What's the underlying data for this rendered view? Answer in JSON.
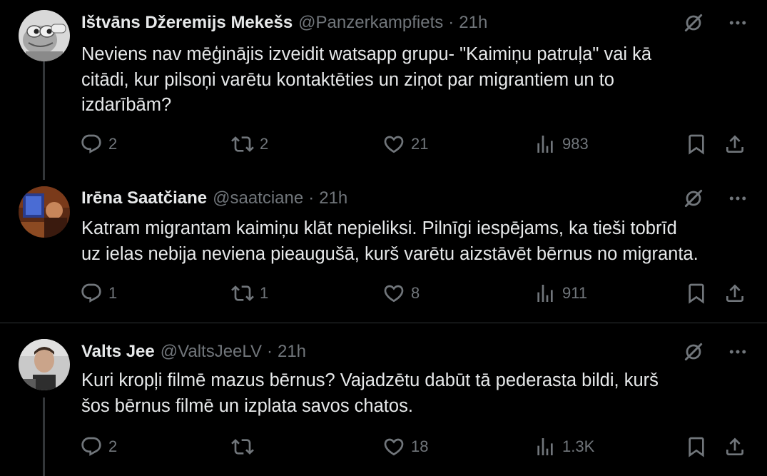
{
  "tweets": [
    {
      "name": "Ištvāns Džeremijs Mekešs",
      "handle": "@Panzerkampfiets",
      "separator": "·",
      "time": "21h",
      "text": "Neviens nav mēģinājis izveidit watsapp grupu- \"Kaimiņu patruļa\" vai kā\ncitādi, kur pilsoņi varētu kontaktēties un ziņot par migrantiem un to\nizdarībām?",
      "replies": "2",
      "reposts": "2",
      "likes": "21",
      "views": "983",
      "avatar_icon": "pepe-frog-avatar"
    },
    {
      "name": "Irēna Saatčiane",
      "handle": "@saatciane",
      "separator": "·",
      "time": "21h",
      "text": "Katram migrantam kaimiņu klāt nepieliksi. Pilnīgi iespējams, ka tieši tobrīd\nuz ielas nebija neviena pieaugušā, kurš varētu aizstāvēt bērnus no migranta.",
      "replies": "1",
      "reposts": "1",
      "likes": "8",
      "views": "911",
      "avatar_icon": "photo-avatar"
    },
    {
      "name": "Valts Jee",
      "handle": "@ValtsJeeLV",
      "separator": "·",
      "time": "21h",
      "text": "Kuri kropļi filmē mazus bērnus?  Vajadzētu dabūt tā pederasta bildi, kurš\nšos bērnus filmē un izplata savos chatos.",
      "replies": "2",
      "reposts": "",
      "likes": "18",
      "views": "1.3K",
      "avatar_icon": "photo-avatar"
    }
  ],
  "colors": {
    "background": "#000000",
    "primary_text": "#e7e9ea",
    "secondary_text": "#71767b",
    "divider": "#2f3336",
    "thread_line": "#333639"
  }
}
